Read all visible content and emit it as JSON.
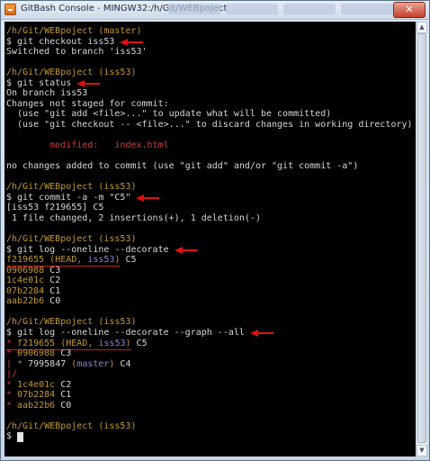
{
  "window": {
    "title": "GitBash Console - MINGW32:/h/Git/WEBpoject",
    "close_label": "✕"
  },
  "terminal": {
    "lines": [
      [
        {
          "t": "/h/Git/WEBpoject (master)",
          "c": "c-prompt"
        }
      ],
      [
        {
          "t": "$ git checkout iss53"
        }
      ],
      [
        {
          "t": "Switched to branch 'iss53'"
        }
      ],
      [],
      [
        {
          "t": "/h/Git/WEBpoject (iss53)",
          "c": "c-prompt"
        }
      ],
      [
        {
          "t": "$ git status"
        }
      ],
      [
        {
          "t": "On branch iss53"
        }
      ],
      [
        {
          "t": "Changes not staged for commit:"
        }
      ],
      [
        {
          "t": "  (use \"git add <file>...\" to update what will be committed)"
        }
      ],
      [
        {
          "t": "  (use \"git checkout -- <file>...\" to discard changes in working directory)"
        }
      ],
      [],
      [
        {
          "t": "        modified:   index.html",
          "c": "c-red"
        }
      ],
      [],
      [
        {
          "t": "no changes added to commit (use \"git add\" and/or \"git commit -a\")"
        }
      ],
      [],
      [
        {
          "t": "/h/Git/WEBpoject (iss53)",
          "c": "c-prompt"
        }
      ],
      [
        {
          "t": "$ git commit -a -m \"C5\""
        }
      ],
      [
        {
          "t": "[iss53 f219655] C5"
        }
      ],
      [
        {
          "t": " 1 file changed, 2 insertions(+), 1 deletion(-)"
        }
      ],
      [],
      [
        {
          "t": "/h/Git/WEBpoject (iss53)",
          "c": "c-prompt"
        }
      ],
      [
        {
          "t": "$ git log --oneline --decorate"
        }
      ],
      [
        {
          "t": "f219655",
          "c": "c-hash"
        },
        {
          "t": " (",
          "c": "c-head"
        },
        {
          "t": "HEAD",
          "c": "c-head"
        },
        {
          "t": ", ",
          "c": "c-head"
        },
        {
          "t": "iss53",
          "c": "c-blue"
        },
        {
          "t": ")",
          "c": "c-head"
        },
        {
          "t": " C5"
        }
      ],
      [
        {
          "t": "0906988",
          "c": "c-hash"
        },
        {
          "t": " C3"
        }
      ],
      [
        {
          "t": "1c4e01c",
          "c": "c-hash"
        },
        {
          "t": " C2"
        }
      ],
      [
        {
          "t": "07b2284",
          "c": "c-hash"
        },
        {
          "t": " C1"
        }
      ],
      [
        {
          "t": "aab22b6",
          "c": "c-hash"
        },
        {
          "t": " C0"
        }
      ],
      [],
      [
        {
          "t": "/h/Git/WEBpoject (iss53)",
          "c": "c-prompt"
        }
      ],
      [
        {
          "t": "$ git log --oneline --decorate --graph --all"
        }
      ],
      [
        {
          "t": "* ",
          "c": "c-red"
        },
        {
          "t": "f219655",
          "c": "c-hash"
        },
        {
          "t": " (",
          "c": "c-head"
        },
        {
          "t": "HEAD",
          "c": "c-head"
        },
        {
          "t": ", ",
          "c": "c-head"
        },
        {
          "t": "iss53",
          "c": "c-blue"
        },
        {
          "t": ")",
          "c": "c-head"
        },
        {
          "t": " C5"
        }
      ],
      [
        {
          "t": "* ",
          "c": "c-red"
        },
        {
          "t": "0906988",
          "c": "c-hash"
        },
        {
          "t": " C3"
        }
      ],
      [
        {
          "t": "| ",
          "c": "c-red"
        },
        {
          "t": "* ",
          "c": "c-green"
        },
        {
          "t": "7995847"
        },
        {
          "t": " (",
          "c": "c-head"
        },
        {
          "t": "master",
          "c": "c-blue"
        },
        {
          "t": ")",
          "c": "c-head"
        },
        {
          "t": " C4"
        }
      ],
      [
        {
          "t": "|/",
          "c": "c-red"
        }
      ],
      [
        {
          "t": "* ",
          "c": "c-red"
        },
        {
          "t": "1c4e01c",
          "c": "c-hash"
        },
        {
          "t": " C2"
        }
      ],
      [
        {
          "t": "* ",
          "c": "c-red"
        },
        {
          "t": "07b2284",
          "c": "c-hash"
        },
        {
          "t": " C1"
        }
      ],
      [
        {
          "t": "* ",
          "c": "c-red"
        },
        {
          "t": "aab22b6",
          "c": "c-hash"
        },
        {
          "t": " C0"
        }
      ],
      [],
      [
        {
          "t": "/h/Git/WEBpoject (iss53)",
          "c": "c-prompt"
        }
      ],
      [
        {
          "t": "$ "
        }
      ]
    ],
    "arrow_lines": [
      1,
      5,
      16,
      21,
      29
    ],
    "underlined_lines": [
      22,
      30
    ]
  }
}
